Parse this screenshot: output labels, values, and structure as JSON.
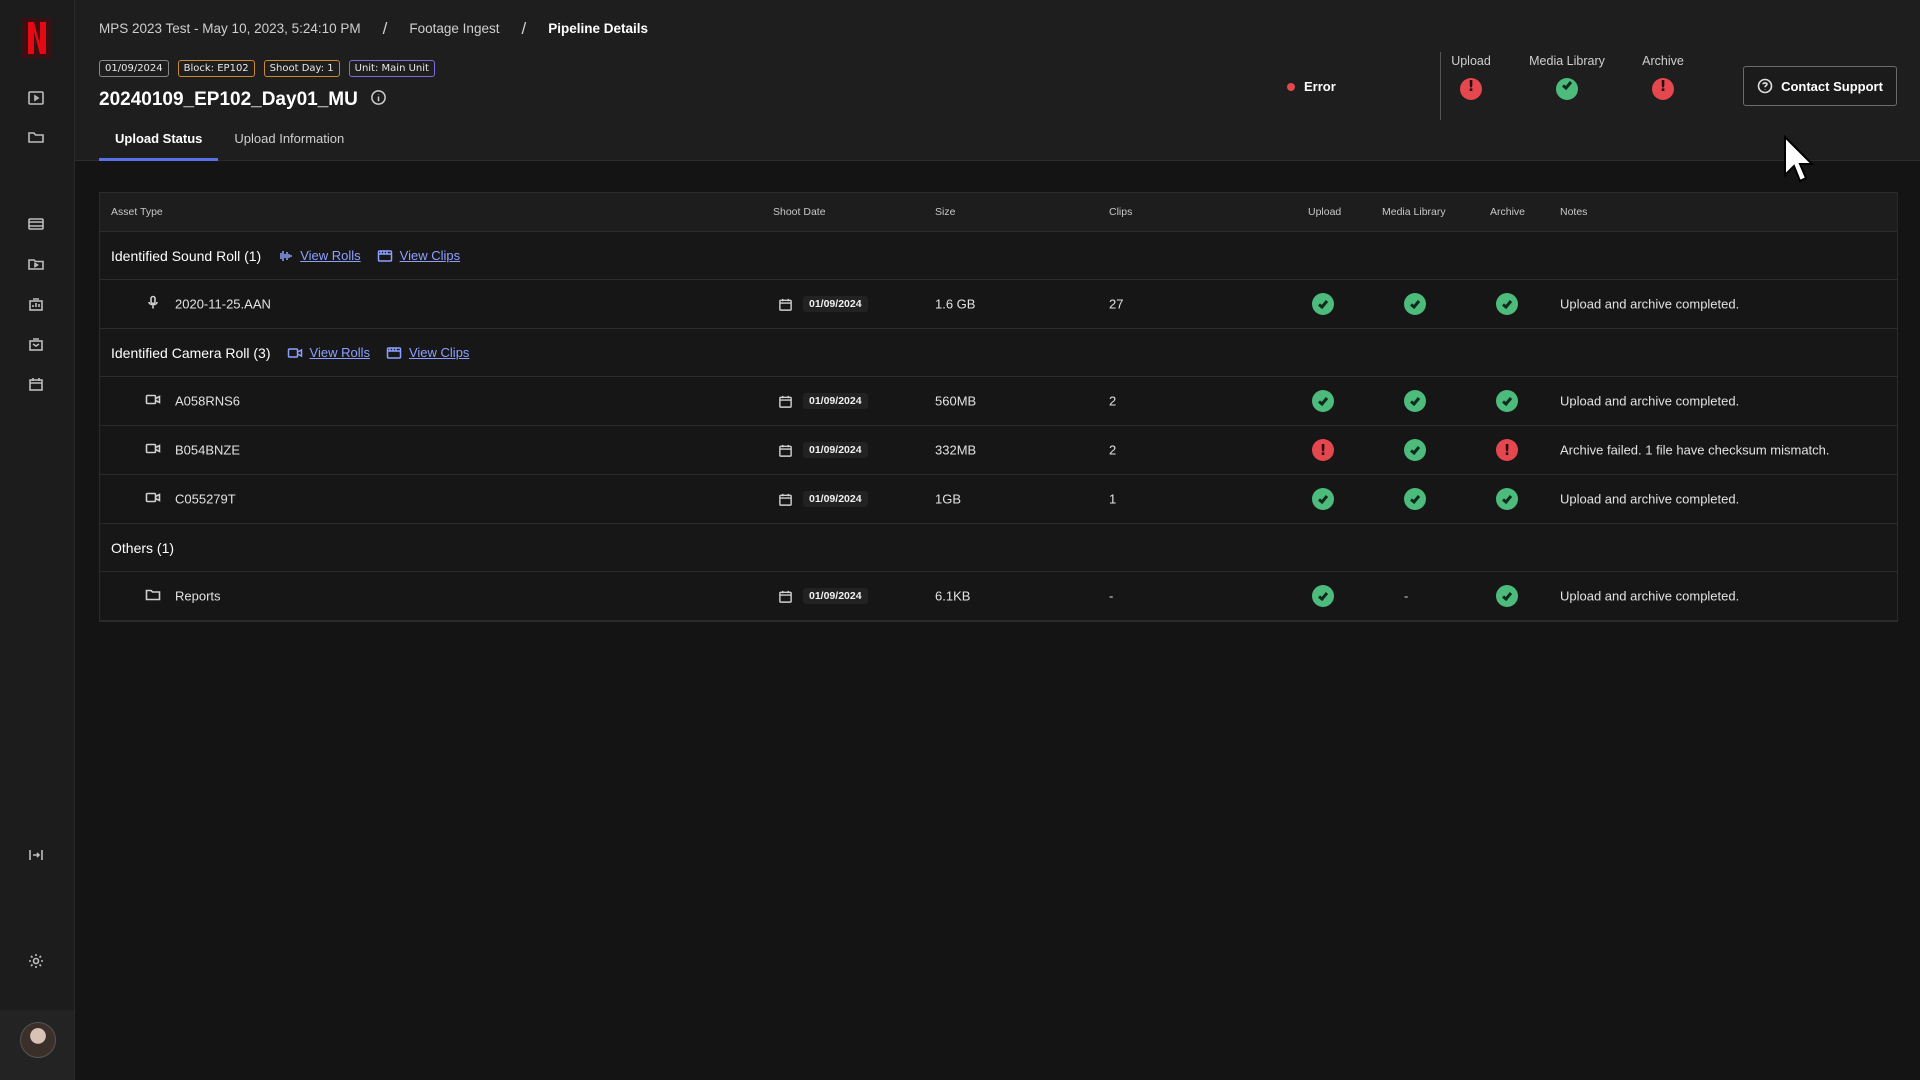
{
  "breadcrumb": [
    "MPS 2023 Test - May 10, 2023, 5:24:10 PM",
    "Footage Ingest",
    "Pipeline Details"
  ],
  "breadcrumb_separator": "/",
  "tags": {
    "date": "01/09/2024",
    "block": "Block: EP102",
    "shoot_day": "Shoot Day: 1",
    "unit": "Unit: Main Unit"
  },
  "title": "20240109_EP102_Day01_MU",
  "tabs": [
    "Upload Status",
    "Upload Information"
  ],
  "overall_status": "Error",
  "summary": [
    {
      "label": "Upload",
      "status": "error"
    },
    {
      "label": "Media Library",
      "status": "ok"
    },
    {
      "label": "Archive",
      "status": "error"
    }
  ],
  "contact_support": "Contact Support",
  "table": {
    "headers": [
      "Asset Type",
      "Shoot Date",
      "Size",
      "Clips",
      "Upload",
      "Media Library",
      "Archive",
      "Notes"
    ],
    "groups": [
      {
        "title": "Identified Sound Roll (1)",
        "links": [
          "View Rolls",
          "View Clips"
        ],
        "kind": "sound",
        "rows": [
          {
            "name": "2020-11-25.AAN",
            "date": "01/09/2024",
            "size": "1.6 GB",
            "clips": "27",
            "upload": "ok",
            "media": "ok",
            "archive": "ok",
            "notes": "Upload and archive completed."
          }
        ]
      },
      {
        "title": "Identified Camera Roll (3)",
        "links": [
          "View Rolls",
          "View Clips"
        ],
        "kind": "camera",
        "rows": [
          {
            "name": "A058RNS6",
            "date": "01/09/2024",
            "size": "560MB",
            "clips": "2",
            "upload": "ok",
            "media": "ok",
            "archive": "ok",
            "notes": "Upload and archive completed."
          },
          {
            "name": "B054BNZE",
            "date": "01/09/2024",
            "size": "332MB",
            "clips": "2",
            "upload": "error",
            "media": "ok",
            "archive": "error",
            "notes": "Archive failed. 1 file have checksum mismatch."
          },
          {
            "name": "C055279T",
            "date": "01/09/2024",
            "size": "1GB",
            "clips": "1",
            "upload": "ok",
            "media": "ok",
            "archive": "ok",
            "notes": "Upload and archive completed."
          }
        ]
      },
      {
        "title": "Others (1)",
        "links": [],
        "kind": "folder",
        "rows": [
          {
            "name": "Reports",
            "date": "01/09/2024",
            "size": "6.1KB",
            "clips": "-",
            "upload": "ok",
            "media": "-",
            "archive": "ok",
            "notes": "Upload and archive completed."
          }
        ]
      }
    ]
  },
  "sidebar_icons": [
    "play-square-icon",
    "folder-icon",
    "film-icon",
    "video-folder-icon",
    "report-icon",
    "inbox-icon",
    "calendar-icon",
    "collapse-icon",
    "gear-icon"
  ],
  "colors": {
    "accent": "#5870e8",
    "ok": "#4cbb7c",
    "error": "#e5474f",
    "link": "#8ea0ff",
    "brand": "#e50914"
  }
}
